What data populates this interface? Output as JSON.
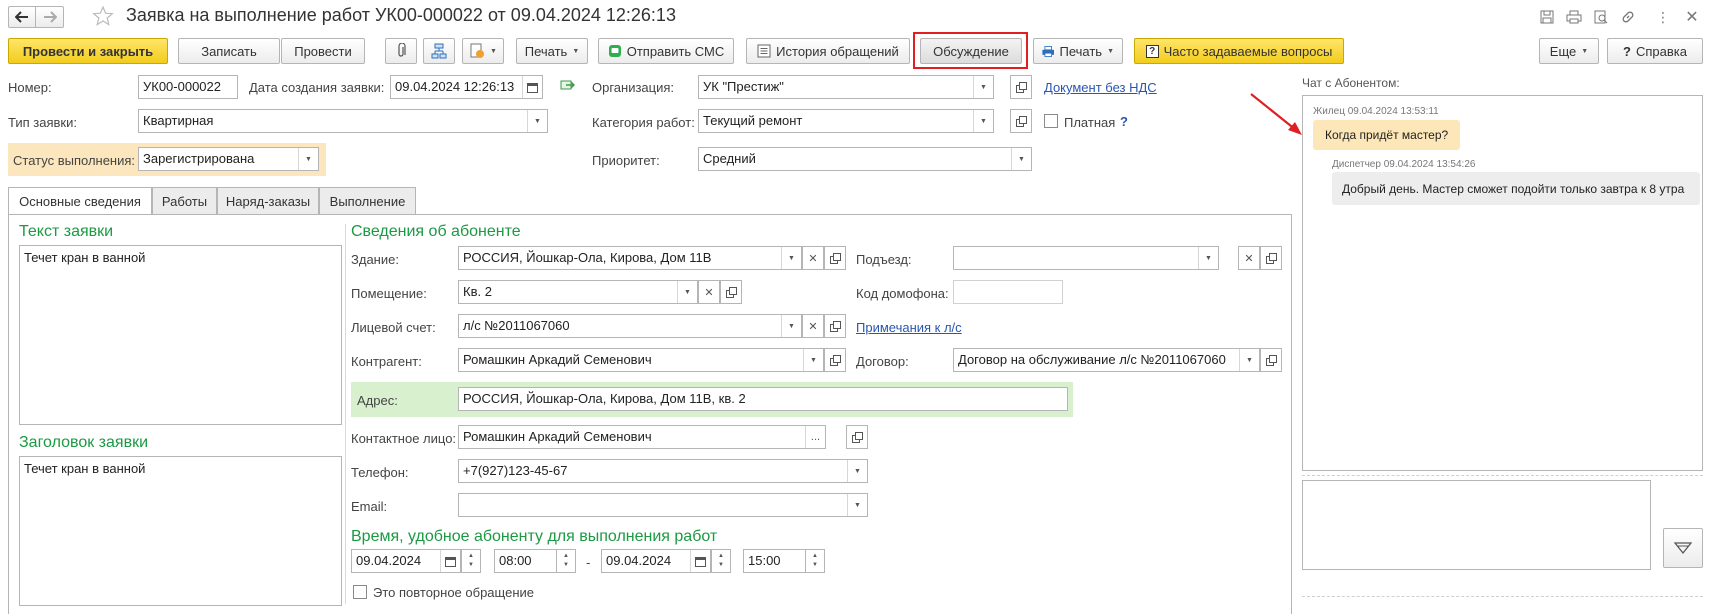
{
  "window": {
    "title": "Заявка на выполнение работ УК00-000022 от 09.04.2024 12:26:13"
  },
  "toolbar": {
    "post_close": "Провести и закрыть",
    "save": "Записать",
    "post": "Провести",
    "print1": "Печать",
    "send_sms": "Отправить СМС",
    "history": "История обращений",
    "discussion": "Обсуждение",
    "print2": "Печать",
    "faq": "Часто задаваемые вопросы",
    "more": "Еще",
    "help": "Справка"
  },
  "header": {
    "number_label": "Номер:",
    "number_value": "УК00-000022",
    "created_label": "Дата создания заявки:",
    "created_value": "09.04.2024 12:26:13",
    "org_label": "Организация:",
    "org_value": "УК \"Престиж\"",
    "doc_link": "Документ без НДС",
    "type_label": "Тип заявки:",
    "type_value": "Квартирная",
    "category_label": "Категория работ:",
    "category_value": "Текущий ремонт",
    "paid_label": "Платная",
    "paid_help": "?",
    "status_label": "Статус выполнения:",
    "status_value": "Зарегистрирована",
    "priority_label": "Приоритет:",
    "priority_value": "Средний"
  },
  "tabs": [
    {
      "label": "Основные сведения"
    },
    {
      "label": "Работы"
    },
    {
      "label": "Наряд-заказы"
    },
    {
      "label": "Выполнение"
    }
  ],
  "request": {
    "text_title": "Текст заявки",
    "text_value": "Течет кран в ванной",
    "heading_title": "Заголовок заявки",
    "heading_value": "Течет кран в ванной"
  },
  "subscriber": {
    "section_title": "Сведения об абоненте",
    "building_label": "Здание:",
    "building_value": "РОССИЯ, Йошкар-Ола, Кирова, Дом 11В",
    "entrance_label": "Подъезд:",
    "entrance_value": "",
    "room_label": "Помещение:",
    "room_value": "Кв. 2",
    "intercom_label": "Код домофона:",
    "intercom_value": "",
    "account_label": "Лицевой счет:",
    "account_value": "л/с №2011067060",
    "account_notes_link": "Примечания к л/с",
    "contractor_label": "Контрагент:",
    "contractor_value": "Ромашкин Аркадий Семенович",
    "contract_label": "Договор:",
    "contract_value": "Договор на обслуживание л/с №2011067060",
    "address_label": "Адрес:",
    "address_value": "РОССИЯ, Йошкар-Ола, Кирова, Дом 11В, кв. 2",
    "contact_label": "Контактное лицо:",
    "contact_value": "Ромашкин Аркадий Семенович",
    "phone_label": "Телефон:",
    "phone_value": "+7(927)123-45-67",
    "email_label": "Email:",
    "email_value": "",
    "time_title": "Время, удобное абоненту для выполнения работ",
    "date_from": "09.04.2024",
    "time_from": "08:00",
    "dash": "-",
    "date_to": "09.04.2024",
    "time_to": "15:00",
    "repeat_label": "Это повторное обращение"
  },
  "chat": {
    "title": "Чат с Абонентом:",
    "messages": [
      {
        "meta": "Жилец 09.04.2024 13:53:11",
        "text": "Когда придёт мастер?"
      },
      {
        "meta": "Диспетчер 09.04.2024 13:54:26",
        "text": "Добрый день. Мастер сможет подойти только завтра к 8 утра"
      }
    ],
    "input_value": ""
  },
  "colors": {
    "primary_button": "#f5d531",
    "accent_green": "#1b9a43",
    "status_bg": "#fbe6bd",
    "address_bg": "#d9f0cf",
    "highlight_red": "#e02020",
    "tenant_bubble": "#fde7b8",
    "dispatcher_bubble": "#ededed"
  },
  "icons": {
    "back": "arrow-left-icon",
    "forward": "arrow-right-icon",
    "favorite": "star-icon",
    "calendar": "calendar-icon"
  }
}
